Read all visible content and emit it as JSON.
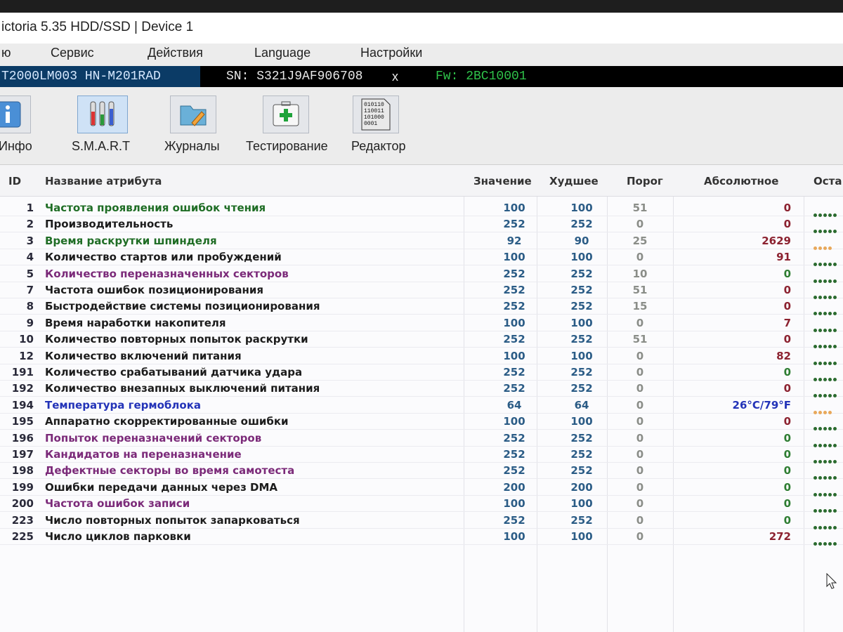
{
  "window": {
    "title": "ictoria 5.35 HDD/SSD | Device 1"
  },
  "menu": [
    "ю",
    "Сервис",
    "Действия",
    "Language",
    "Настройки"
  ],
  "device": {
    "model": "T2000LM003 HN-M201RAD",
    "serial": "SN: S321J9AF906708",
    "close": "x",
    "firmware": "Fw: 2BC10001"
  },
  "toolbar": [
    {
      "label": "Инфо",
      "icon": "info-icon"
    },
    {
      "label": "S.M.A.R.T",
      "icon": "test-tubes-icon"
    },
    {
      "label": "Журналы",
      "icon": "folder-pen-icon"
    },
    {
      "label": "Тестирование",
      "icon": "first-aid-kit-icon"
    },
    {
      "label": "Редактор",
      "icon": "binary-document-icon"
    }
  ],
  "columns": {
    "id": "ID",
    "name": "Название атрибута",
    "value": "Значение",
    "worst": "Худшее",
    "threshold": "Порог",
    "absolute": "Абсолютное",
    "remaining": "Оста"
  },
  "colors": {
    "name_green": "#1f6d25",
    "name_black": "#1c1c1c",
    "name_purple": "#7b2a79",
    "name_blue": "#2333b8",
    "dot_green": "#2b6b2f",
    "dot_orange": "#e8a85a",
    "value_blue": "#2b5c86",
    "abs_red": "#8c2230",
    "abs_green": "#2e7d32"
  },
  "rows": [
    {
      "id": "1",
      "name": "Частота проявления ошибок чтения",
      "color": "green",
      "value": "100",
      "worst": "100",
      "threshold": "51",
      "absolute": "0",
      "abs_color": "red",
      "dots": 5,
      "dot_color": "green"
    },
    {
      "id": "2",
      "name": "Производительность",
      "color": "black",
      "value": "252",
      "worst": "252",
      "threshold": "0",
      "absolute": "0",
      "abs_color": "red",
      "dots": 5,
      "dot_color": "green"
    },
    {
      "id": "3",
      "name": "Время раскрутки шпинделя",
      "color": "green",
      "value": "92",
      "worst": "90",
      "threshold": "25",
      "absolute": "2629",
      "abs_color": "red",
      "dots": 4,
      "dot_color": "orange"
    },
    {
      "id": "4",
      "name": "Количество стартов или пробуждений",
      "color": "black",
      "value": "100",
      "worst": "100",
      "threshold": "0",
      "absolute": "91",
      "abs_color": "red",
      "dots": 5,
      "dot_color": "green"
    },
    {
      "id": "5",
      "name": "Количество переназначенных секторов",
      "color": "purple",
      "value": "252",
      "worst": "252",
      "threshold": "10",
      "absolute": "0",
      "abs_color": "green",
      "dots": 5,
      "dot_color": "green"
    },
    {
      "id": "7",
      "name": "Частота ошибок позиционирования",
      "color": "black",
      "value": "252",
      "worst": "252",
      "threshold": "51",
      "absolute": "0",
      "abs_color": "red",
      "dots": 5,
      "dot_color": "green"
    },
    {
      "id": "8",
      "name": "Быстродействие системы позиционирования",
      "color": "black",
      "value": "252",
      "worst": "252",
      "threshold": "15",
      "absolute": "0",
      "abs_color": "red",
      "dots": 5,
      "dot_color": "green"
    },
    {
      "id": "9",
      "name": "Время наработки накопителя",
      "color": "black",
      "value": "100",
      "worst": "100",
      "threshold": "0",
      "absolute": "7",
      "abs_color": "red",
      "dots": 5,
      "dot_color": "green"
    },
    {
      "id": "10",
      "name": "Количество повторных попыток раскрутки",
      "color": "black",
      "value": "252",
      "worst": "252",
      "threshold": "51",
      "absolute": "0",
      "abs_color": "red",
      "dots": 5,
      "dot_color": "green"
    },
    {
      "id": "12",
      "name": "Количество включений питания",
      "color": "black",
      "value": "100",
      "worst": "100",
      "threshold": "0",
      "absolute": "82",
      "abs_color": "red",
      "dots": 5,
      "dot_color": "green"
    },
    {
      "id": "191",
      "name": "Количество срабатываний датчика удара",
      "color": "black",
      "value": "252",
      "worst": "252",
      "threshold": "0",
      "absolute": "0",
      "abs_color": "green",
      "dots": 5,
      "dot_color": "green"
    },
    {
      "id": "192",
      "name": "Количество внезапных выключений питания",
      "color": "black",
      "value": "252",
      "worst": "252",
      "threshold": "0",
      "absolute": "0",
      "abs_color": "red",
      "dots": 5,
      "dot_color": "green"
    },
    {
      "id": "194",
      "name": "Температура гермоблока",
      "color": "blue",
      "value": "64",
      "worst": "64",
      "threshold": "0",
      "absolute": "26°C/79°F",
      "abs_color": "blue",
      "dots": 4,
      "dot_color": "orange"
    },
    {
      "id": "195",
      "name": "Аппаратно скорректированные ошибки",
      "color": "black",
      "value": "100",
      "worst": "100",
      "threshold": "0",
      "absolute": "0",
      "abs_color": "red",
      "dots": 5,
      "dot_color": "green"
    },
    {
      "id": "196",
      "name": "Попыток переназначений секторов",
      "color": "purple",
      "value": "252",
      "worst": "252",
      "threshold": "0",
      "absolute": "0",
      "abs_color": "green",
      "dots": 5,
      "dot_color": "green"
    },
    {
      "id": "197",
      "name": "Кандидатов на переназначение",
      "color": "purple",
      "value": "252",
      "worst": "252",
      "threshold": "0",
      "absolute": "0",
      "abs_color": "green",
      "dots": 5,
      "dot_color": "green"
    },
    {
      "id": "198",
      "name": "Дефектные секторы во время самотеста",
      "color": "purple",
      "value": "252",
      "worst": "252",
      "threshold": "0",
      "absolute": "0",
      "abs_color": "green",
      "dots": 5,
      "dot_color": "green"
    },
    {
      "id": "199",
      "name": "Ошибки передачи данных через DMA",
      "color": "black",
      "value": "200",
      "worst": "200",
      "threshold": "0",
      "absolute": "0",
      "abs_color": "green",
      "dots": 5,
      "dot_color": "green"
    },
    {
      "id": "200",
      "name": "Частота ошибок записи",
      "color": "purple",
      "value": "100",
      "worst": "100",
      "threshold": "0",
      "absolute": "0",
      "abs_color": "green",
      "dots": 5,
      "dot_color": "green"
    },
    {
      "id": "223",
      "name": "Число повторных попыток запарковаться",
      "color": "black",
      "value": "252",
      "worst": "252",
      "threshold": "0",
      "absolute": "0",
      "abs_color": "green",
      "dots": 5,
      "dot_color": "green"
    },
    {
      "id": "225",
      "name": "Число циклов парковки",
      "color": "black",
      "value": "100",
      "worst": "100",
      "threshold": "0",
      "absolute": "272",
      "abs_color": "red",
      "dots": 5,
      "dot_color": "green"
    }
  ]
}
